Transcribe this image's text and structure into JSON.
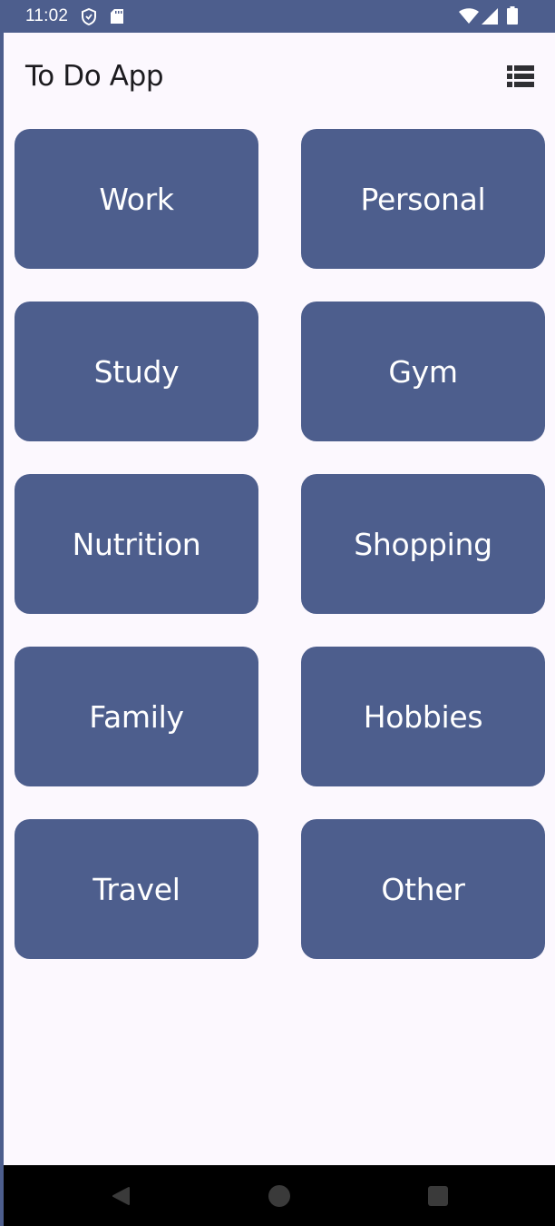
{
  "status_bar": {
    "time": "11:02",
    "icons": [
      "shield-icon",
      "sd-card-icon",
      "wifi-icon",
      "cellular-signal-icon",
      "battery-icon"
    ]
  },
  "app_bar": {
    "title": "To Do App",
    "menu_icon": "list-view-icon"
  },
  "categories": [
    {
      "label": "Work"
    },
    {
      "label": "Personal"
    },
    {
      "label": "Study"
    },
    {
      "label": "Gym"
    },
    {
      "label": "Nutrition"
    },
    {
      "label": "Shopping"
    },
    {
      "label": "Family"
    },
    {
      "label": "Hobbies"
    },
    {
      "label": "Travel"
    },
    {
      "label": "Other"
    }
  ],
  "nav_bar": {
    "icons": [
      "back-icon",
      "home-icon",
      "recents-icon"
    ]
  },
  "colors": {
    "primary": "#4d5e8d",
    "background": "#fcf8fe",
    "on_primary": "#ffffff",
    "text": "#1c1b1f",
    "nav_bar": "#000000"
  }
}
